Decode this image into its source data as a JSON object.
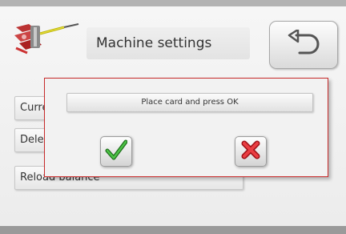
{
  "header": {
    "logo_icon": "cables-connector-icon",
    "title": "Machine settings",
    "back_icon": "undo-arrow-icon"
  },
  "menu": {
    "items": [
      {
        "label": "Curre"
      },
      {
        "label": "Dele"
      },
      {
        "label": "Reload balance"
      }
    ]
  },
  "dialog": {
    "message": "Place card and press OK",
    "ok_icon": "green-check-icon",
    "cancel_icon": "red-x-icon"
  },
  "colors": {
    "dialog_border": "#c72a2a",
    "ok_green": "#2e8f2a",
    "cancel_red": "#d9272d"
  }
}
